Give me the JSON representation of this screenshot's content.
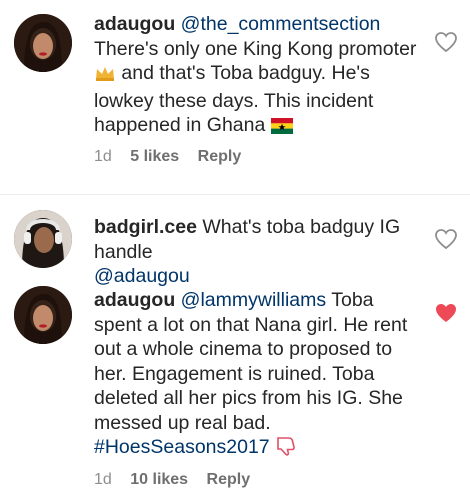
{
  "comments": [
    {
      "username": "adaugou",
      "mention": "@the_commentsection",
      "text_part1": "There's only one King Kong promoter",
      "emoji1": "crown",
      "text_part2": "and that's Toba badguy. He's lowkey these days. This incident happened in Ghana",
      "emoji2": "ghana-flag",
      "time": "1d",
      "likes": "5 likes",
      "reply": "Reply",
      "liked": false
    },
    {
      "username": "badgirl.cee",
      "text": "What's toba badguy  IG handle",
      "mention": "@adaugou",
      "liked": false
    },
    {
      "username": "adaugou",
      "mention": "@lammywilliams",
      "text": "Toba spent a lot on that Nana girl. He rent out a whole cinema to proposed to her. Engagement is ruined. Toba deleted all her pics from his IG. She messed up real bad.",
      "hashtag": "#HoesSeasons2017",
      "emoji": "thumbs-down",
      "time": "1d",
      "likes": "10 likes",
      "reply": "Reply",
      "liked": true
    }
  ],
  "colors": {
    "link": "#003569",
    "meta": "#8e8e8e",
    "heart_liked": "#ed4956",
    "heart_outline": "#8e8e8e"
  }
}
